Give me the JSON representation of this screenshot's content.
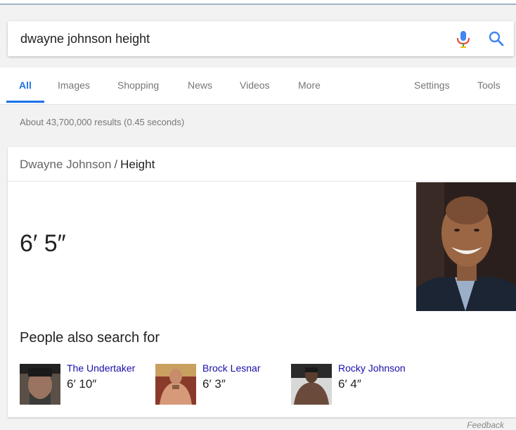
{
  "search": {
    "query": "dwayne johnson height"
  },
  "nav": {
    "tabs": [
      "All",
      "Images",
      "Shopping",
      "News",
      "Videos",
      "More"
    ],
    "right": [
      "Settings",
      "Tools"
    ]
  },
  "stats": "About 43,700,000 results (0.45 seconds)",
  "card": {
    "breadcrumb_entity": "Dwayne Johnson",
    "breadcrumb_sep": "/",
    "breadcrumb_attr": "Height",
    "answer": "6′ 5″",
    "people_title": "People also search for",
    "people": [
      {
        "name": "The Undertaker",
        "height": "6′ 10″"
      },
      {
        "name": "Brock Lesnar",
        "height": "6′ 3″"
      },
      {
        "name": "Rocky Johnson",
        "height": "6′ 4″"
      }
    ]
  },
  "feedback": "Feedback",
  "colors": {
    "accent": "#1a73e8",
    "link": "#1a0dab"
  }
}
